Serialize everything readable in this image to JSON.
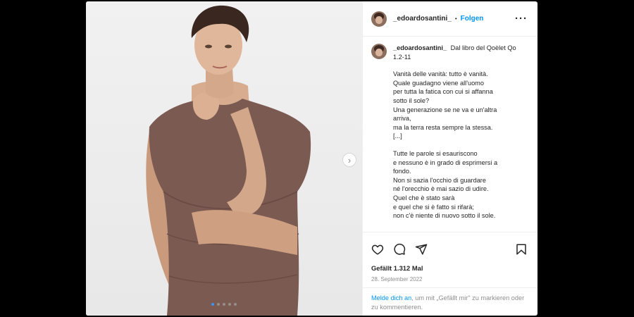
{
  "post": {
    "username": "_edoardosantini_",
    "separator": "•",
    "follow_label": "Folgen",
    "more_icon": "more-horizontal-icon",
    "caption_title": "Dal libro del Qoèlet Qo 1.2-11",
    "caption_paragraphs": [
      [
        "Vanità delle vanità: tutto è vanità.",
        "Quale guadagno viene all'uomo",
        "per tutta la fatica con cui si affanna",
        "sotto il sole?",
        "Una generazione se ne va e un'altra",
        "arriva,",
        "ma la terra resta sempre la stessa.",
        "[...]"
      ],
      [
        "Tutte le parole si esauriscono",
        "e nessuno è in grado di esprimersi a",
        "fondo.",
        "Non si sazia l'occhio di guardare",
        "né l'orecchio è mai sazio di udire.",
        "Quel che è stato sarà",
        "e quel che si è fatto si rifarà;",
        "non c'è niente di nuovo sotto il sole."
      ]
    ],
    "likes": "Gefällt 1.312 Mal",
    "date": "28. September 2022",
    "login_link": "Melde dich an",
    "login_text": ", um mit „Gefällt mir\" zu markieren oder zu kommentieren.",
    "carousel": {
      "slides": 5,
      "active": 1,
      "next_icon": "chevron-right-icon"
    },
    "actions": [
      "heart-icon",
      "comment-icon",
      "share-icon",
      "bookmark-icon"
    ],
    "colors": {
      "accent": "#0095f6",
      "carousel_active": "#3897f0",
      "muted": "#8e8e8e"
    }
  }
}
